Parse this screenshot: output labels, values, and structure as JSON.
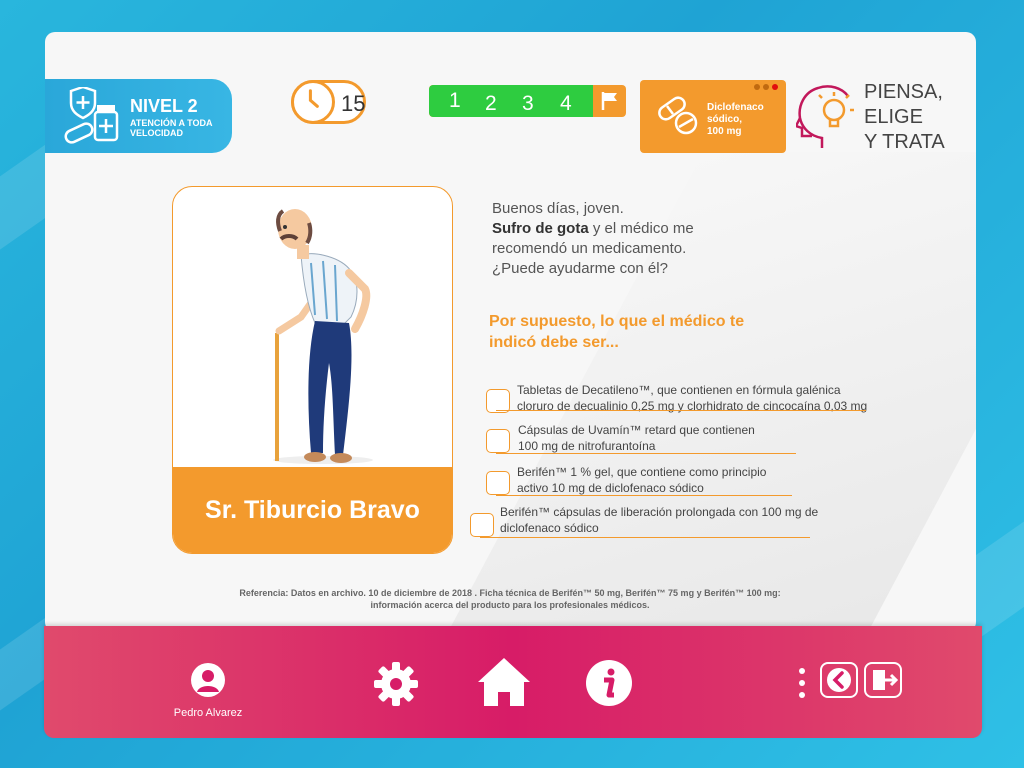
{
  "level": {
    "title": "NIVEL 2",
    "subtitle": "ATENCIÓN A TODA VELOCIDAD"
  },
  "timer": {
    "value": "15"
  },
  "progress": {
    "steps": [
      "1",
      "2",
      "3",
      "4"
    ],
    "completed_fraction": 0.83
  },
  "drug": {
    "text_line1": "Diclofenaco",
    "text_line2": "sódico,",
    "text_line3": "100 mg"
  },
  "slogan": {
    "line1": "PIENSA,",
    "line2": "ELIGE",
    "line3": "Y TRATA"
  },
  "patient": {
    "name": "Sr. Tiburcio Bravo"
  },
  "speech": {
    "line1": "Buenos días, joven.",
    "bold": "Sufro de gota",
    "line2_rest": " y el médico me",
    "line3": "recomendó un medicamento.",
    "line4": " ¿Puede ayudarme con él?"
  },
  "question": {
    "line1": "Por supuesto, lo que el médico te",
    "line2": "indicó debe ser..."
  },
  "options": [
    {
      "line1": "Tabletas de Decatileno™, que contienen en fórmula galénica",
      "line2": "cloruro de decualinio 0,25 mg y clorhidrato de cincocaína 0,03 mg"
    },
    {
      "line1": "Cápsulas de Uvamín™ retard que  contienen",
      "line2": "100 mg de nitrofurantoína"
    },
    {
      "line1": "Berifén™ 1 % gel, que contiene como principio",
      "line2": "activo 10 mg de diclofenaco sódico"
    },
    {
      "line1": "Berifén™ cápsulas de liberación prolongada con 100 mg de",
      "line2": "diclofenaco sódico"
    }
  ],
  "reference": {
    "line1": "Referencia: Datos en archivo. 10 de diciembre de 2018 . Ficha técnica de Berifén™ 50 mg, Berifén™ 75 mg y Berifén™ 100 mg:",
    "line2": "información acerca del producto para los profesionales médicos."
  },
  "user": {
    "name": "Pedro Alvarez"
  },
  "colors": {
    "orange": "#f39a2d",
    "green": "#2ecc40",
    "magenta": "#d71c67",
    "blue": "#2aa7d9"
  },
  "icons": [
    "medicine-icon",
    "clock-icon",
    "flag-icon",
    "pill-icon",
    "thinking-head-icon",
    "user-avatar-icon",
    "gear-icon",
    "home-icon",
    "info-icon",
    "more-icon",
    "back-icon",
    "exit-icon"
  ]
}
